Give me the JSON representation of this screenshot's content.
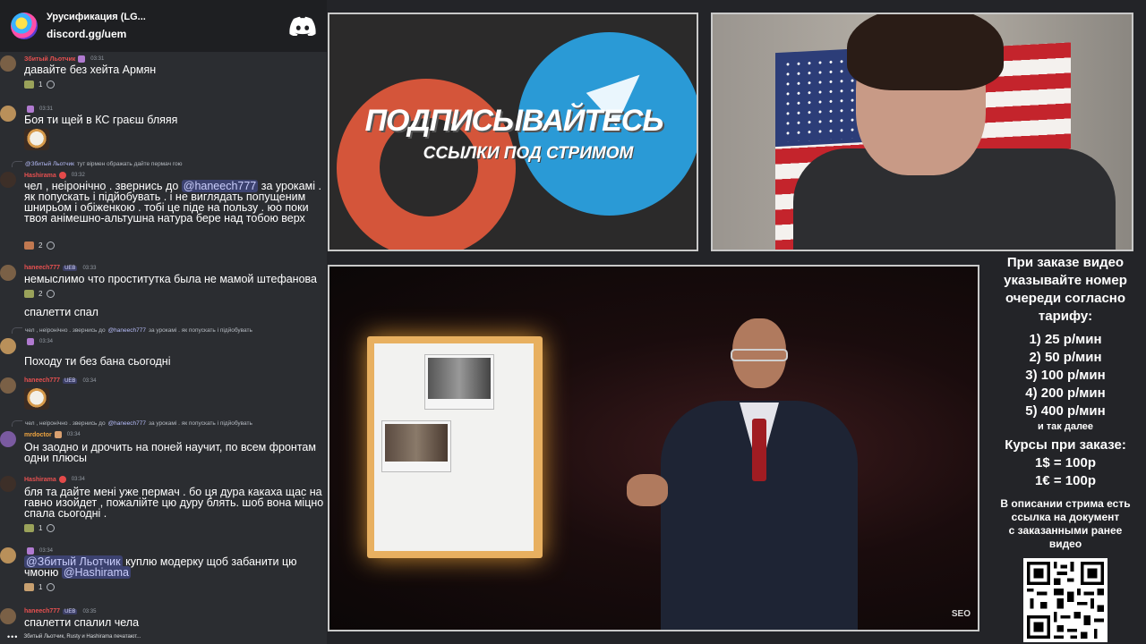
{
  "chat": {
    "server_name": "Урусификация (LG...",
    "server_invite": "discord.gg/uem",
    "messages": [
      {
        "author": "Збитый Льотчик",
        "time": "03:31",
        "text": "давайте без хейта Армян",
        "reaction_count": "1"
      },
      {
        "author": "",
        "time": "03:31",
        "text": "Боя ти щей в КС граєш бляяя"
      },
      {
        "reply_text": "тут вірмен ображать дайте пермач гою",
        "reply_mention": "@Збитый Льотчик",
        "author": "Hashirama",
        "time": "03:32",
        "text_before": "чел , неіронічно .  звернись до ",
        "mention": "@haneech777",
        "text_after": " за урокамі . як попускать і підйобувать . і не виглядать попущеним шнирьом  і обіженкою . тобі це піде на пользу .  юо поки твоя анімешно-альтушна натура бере над тобою верх",
        "reaction_count": "2"
      },
      {
        "author": "haneech777",
        "tag": "UEB",
        "time": "03:33",
        "text": "немыслимо что проститутка была не мамой штефанова",
        "reaction_count": "2"
      },
      {
        "text": "спалетти спал"
      },
      {
        "reply_text": "чел , неіронічно .  звернись до ",
        "reply_mention": "@haneech777",
        "reply_tail": " за урокамі . як попускать і підйобувать",
        "author": "",
        "time": "03:34",
        "text": "Походу ти без бана сьогодні"
      },
      {
        "author": "haneech777",
        "tag": "UEB",
        "time": "03:34"
      },
      {
        "reply_text": "чел , неіронічно .  звернись до ",
        "reply_mention": "@haneech777",
        "reply_tail": " за урокамі . як попускать і підйобувать",
        "author": "mrdoctor",
        "time": "03:34",
        "text": "Он заодно и дрочить на поней научит, по всем фронтам одни плюсы"
      },
      {
        "author": "Hashirama",
        "time": "03:34",
        "text": "бля та дайте мені уже пермач . бо ця дура какаха щас на гавно изойдет ,  пожалійте цю дуру блять. шоб вона мiцно спала сьогодні .",
        "reaction_count": "1"
      },
      {
        "author": "",
        "time": "03:34",
        "mention1": "@Збитый Льотчик",
        "text_mid": " куплю модерку щоб забанити цю чмоню ",
        "mention2": "@Hashirama",
        "reaction_count": "1"
      },
      {
        "author": "haneech777",
        "tag": "UEB",
        "time": "03:35",
        "text": "спалетти спалил чела"
      }
    ],
    "typing": "Збитый Льотчик, Rusty и Hashirama печатают..."
  },
  "promo": {
    "title": "ПОДПИСЫВАЙТЕСЬ",
    "subtitle": "ССЫЛКИ ПОД СТРИМОМ"
  },
  "video": {
    "logo": "SEO"
  },
  "info": {
    "heading": [
      "При заказе видео",
      "указывайте номер",
      "очереди согласно",
      "тарифу:"
    ],
    "prices": [
      "1) 25 р/мин",
      "2) 50 р/мин",
      "3) 100 р/мин",
      "4) 200 р/мин",
      "5) 400 р/мин"
    ],
    "etc": "и так далее",
    "rates_title": "Курсы при заказе:",
    "rates": [
      "1$ = 100р",
      "1€ = 100р"
    ],
    "description": [
      "В описании стрима есть",
      "ссылка на документ",
      "с заказанными ранее",
      "видео"
    ]
  },
  "colors": {
    "discord_bg": "#2b2d31",
    "header_bg": "#1e1f22",
    "mention_bg": "#3c4270",
    "telegram_blue": "#2a9ad6",
    "patreon_red": "#d4553a"
  }
}
